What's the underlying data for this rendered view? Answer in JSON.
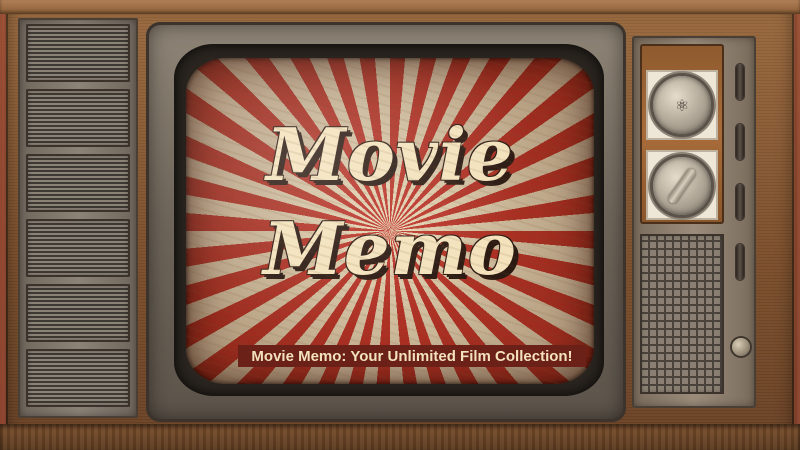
{
  "screen": {
    "title_line1": "Movie",
    "title_line2": "Memo",
    "subtitle": "Movie Memo: Your Unlimited Film Collection!"
  },
  "icons": {
    "dial_top": "atom-icon",
    "dial_bottom": "knob-handle-icon"
  },
  "colors": {
    "ray_red": "#c2362b",
    "ray_cream": "#e8d9b8",
    "title_fill": "#f3e2bc",
    "title_outline": "#2b1a12",
    "subtitle_bg": "#6b2018"
  }
}
